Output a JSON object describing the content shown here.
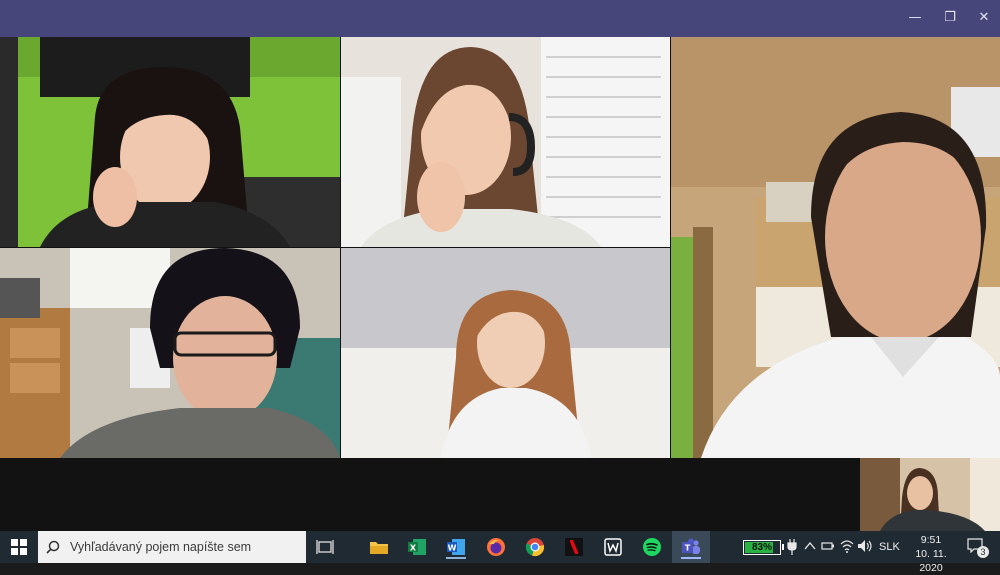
{
  "window": {
    "minimize_glyph": "—",
    "restore_glyph": "❐",
    "close_glyph": "✕"
  },
  "call": {
    "participants": [
      {
        "name": "participant-tile-1",
        "wall": "#7ec23a"
      },
      {
        "name": "participant-tile-2",
        "wall": "#e7e3dc"
      },
      {
        "name": "participant-tile-3",
        "wall": "#c7a57a"
      },
      {
        "name": "participant-tile-4",
        "wall": "#c9c2b6"
      },
      {
        "name": "participant-tile-5",
        "wall": "#c8c8cc"
      }
    ],
    "self_view": {
      "label": "self-view"
    }
  },
  "taskbar": {
    "search_placeholder": "Vyhľadávaný pojem napíšte sem",
    "apps": [
      {
        "id": "task-view",
        "icon": "task-view-icon"
      },
      {
        "id": "file-explorer",
        "icon": "folder-icon"
      },
      {
        "id": "excel",
        "icon": "excel-icon"
      },
      {
        "id": "word",
        "icon": "word-icon"
      },
      {
        "id": "firefox",
        "icon": "firefox-icon"
      },
      {
        "id": "chrome",
        "icon": "chrome-icon"
      },
      {
        "id": "netflix",
        "icon": "netflix-icon"
      },
      {
        "id": "wunderlist",
        "icon": "wunderlist-icon"
      },
      {
        "id": "spotify",
        "icon": "spotify-icon"
      },
      {
        "id": "teams",
        "icon": "teams-icon",
        "active": true
      }
    ],
    "battery": {
      "percent_text": "83%",
      "level": 0.83
    },
    "language": "SLK",
    "time": "9:51",
    "date": "10. 11. 2020",
    "notification_count": "3"
  },
  "colors": {
    "titlebar": "#46467a",
    "taskbar": "#1f2a33",
    "battery_green": "#29b342"
  }
}
